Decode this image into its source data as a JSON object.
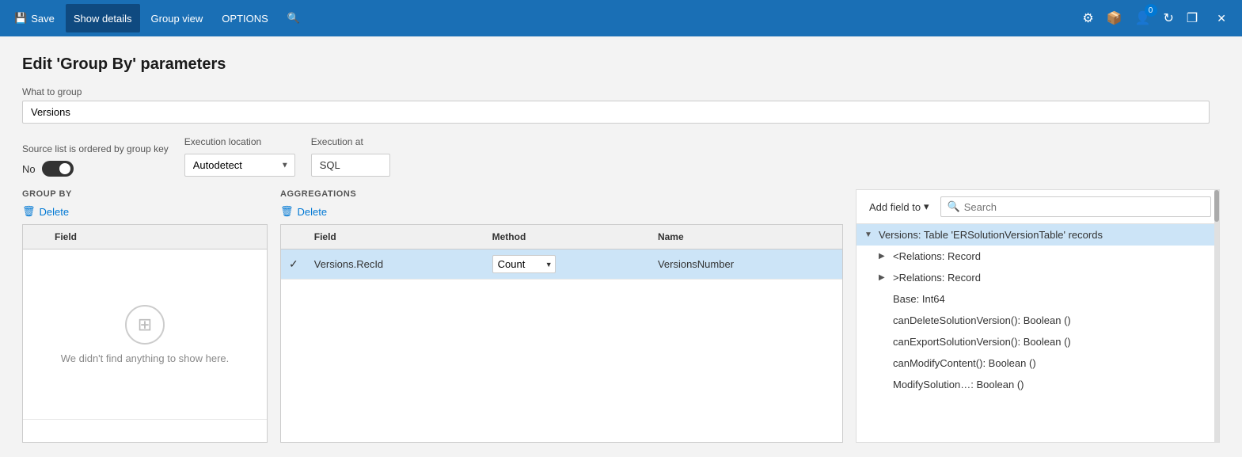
{
  "titlebar": {
    "save_label": "Save",
    "show_details_label": "Show details",
    "group_view_label": "Group view",
    "options_label": "OPTIONS",
    "search_icon_label": "🔍"
  },
  "page": {
    "title": "Edit 'Group By' parameters",
    "what_to_group_label": "What to group",
    "what_to_group_value": "Versions",
    "source_ordered_label": "Source list is ordered by group key",
    "toggle_value": "No",
    "execution_location_label": "Execution location",
    "execution_location_value": "Autodetect",
    "execution_at_label": "Execution at",
    "execution_at_value": "SQL"
  },
  "group_by": {
    "section_label": "GROUP BY",
    "delete_label": "Delete",
    "field_col": "Field",
    "empty_message": "We didn't find anything to show here."
  },
  "aggregations": {
    "section_label": "AGGREGATIONS",
    "delete_label": "Delete",
    "field_col": "Field",
    "method_col": "Method",
    "name_col": "Name",
    "rows": [
      {
        "checked": true,
        "field": "Versions.RecId",
        "method": "Count",
        "name": "VersionsNumber"
      }
    ]
  },
  "right_panel": {
    "add_field_label": "Add field to",
    "search_placeholder": "Search",
    "tree_items": [
      {
        "level": 0,
        "label": "Versions: Table 'ERSolutionVersionTable' records",
        "has_children": true,
        "expanded": true,
        "selected": true
      },
      {
        "level": 1,
        "label": "<Relations: Record",
        "has_children": true,
        "expanded": false,
        "selected": false
      },
      {
        "level": 1,
        "label": ">Relations: Record",
        "has_children": true,
        "expanded": false,
        "selected": false
      },
      {
        "level": 1,
        "label": "Base: Int64",
        "has_children": false,
        "expanded": false,
        "selected": false
      },
      {
        "level": 1,
        "label": "canDeleteSolutionVersion(): Boolean ()",
        "has_children": false,
        "expanded": false,
        "selected": false
      },
      {
        "level": 1,
        "label": "canExportSolutionVersion(): Boolean ()",
        "has_children": false,
        "expanded": false,
        "selected": false
      },
      {
        "level": 1,
        "label": "canModifyContent(): Boolean ()",
        "has_children": false,
        "expanded": false,
        "selected": false
      },
      {
        "level": 1,
        "label": "ModifySolution…: Boolean ()",
        "has_children": false,
        "expanded": false,
        "selected": false
      }
    ]
  },
  "window_controls": {
    "minimize": "—",
    "restore": "❐",
    "close": "✕"
  }
}
